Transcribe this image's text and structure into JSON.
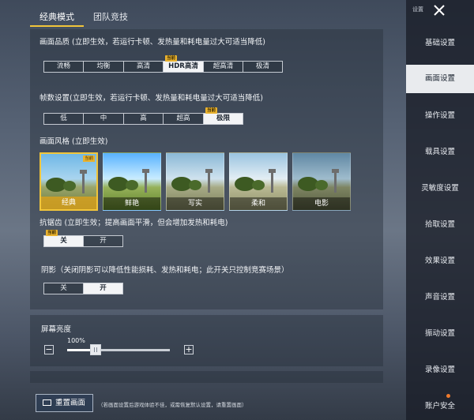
{
  "tabs": [
    {
      "label": "经典模式",
      "active": true
    },
    {
      "label": "团队竞技",
      "active": false
    }
  ],
  "quality": {
    "title": "画面品质 (立即生效，若运行卡顿、发热量和耗电量过大可适当降低)",
    "options": [
      "流畅",
      "均衡",
      "高清",
      "HDR高清",
      "超高清",
      "极清"
    ],
    "selected": "HDR高清",
    "badge": "当前"
  },
  "fps": {
    "title": "帧数设置(立即生效，若运行卡顿、发热量和耗电量过大可适当降低)",
    "options": [
      "低",
      "中",
      "高",
      "超高",
      "极限"
    ],
    "selected": "极限",
    "badge": "当前"
  },
  "style": {
    "title": "画面风格 (立即生效)",
    "options": [
      "经典",
      "鲜艳",
      "写实",
      "柔和",
      "电影"
    ],
    "selected": "经典",
    "badge": "当前"
  },
  "antialias": {
    "title": "抗锯齿 (立即生效；提高画面平滑，但会增加发热和耗电)",
    "options": [
      "关",
      "开"
    ],
    "selected": "关",
    "badge": "当前"
  },
  "shadow": {
    "title": "阴影（关闭阴影可以降低性能损耗、发热和耗电；此开关只控制竞赛场景）",
    "options": [
      "关",
      "开"
    ],
    "selected": "开"
  },
  "brightness": {
    "title": "屏幕亮度",
    "value_label": "100%",
    "level": 0.28,
    "minus": "−",
    "plus": "+"
  },
  "reset": {
    "label": "重置画面",
    "hint": "（若画面设置后游戏体验不佳，或需恢复默认设置，请重置画面）"
  },
  "sidebar": {
    "title": "设置",
    "items": [
      "基础设置",
      "画面设置",
      "操作设置",
      "载具设置",
      "灵敏度设置",
      "拾取设置",
      "效果设置",
      "声音设置",
      "振动设置",
      "录像设置",
      "账户安全"
    ],
    "active": "画面设置"
  },
  "colors": {
    "accent": "#f1c53a",
    "badge": "#e9b22f",
    "dot": "#f07a2c"
  }
}
